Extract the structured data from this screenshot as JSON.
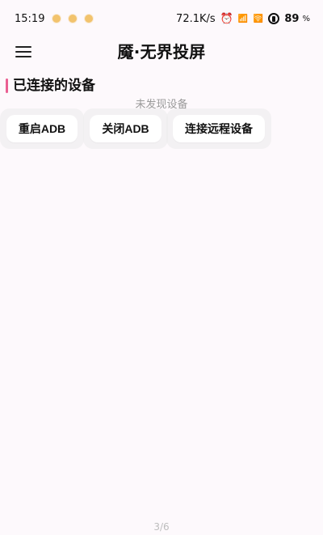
{
  "status_bar": {
    "time": "15:19",
    "speed": "72.1K/s",
    "battery_level": "89",
    "battery_unit": "%"
  },
  "app_bar": {
    "title": "魇·无界投屏"
  },
  "devices_section": {
    "title": "已连接的设备",
    "empty_text": "未发现设备"
  },
  "actions": {
    "restart_adb": "重启ADB",
    "close_adb": "关闭ADB",
    "connect_remote": "连接远程设备"
  },
  "pager": {
    "label": "3/6"
  },
  "colors": {
    "accent": "#ea5f92",
    "background": "#fdf9fc",
    "button_bg": "#ffffff",
    "dot": "#f2c36d"
  },
  "icons": {
    "menu": "menu-icon",
    "alarm": "alarm-icon",
    "signal": "signal-icon",
    "network": "network-icon",
    "battery": "battery-icon"
  }
}
